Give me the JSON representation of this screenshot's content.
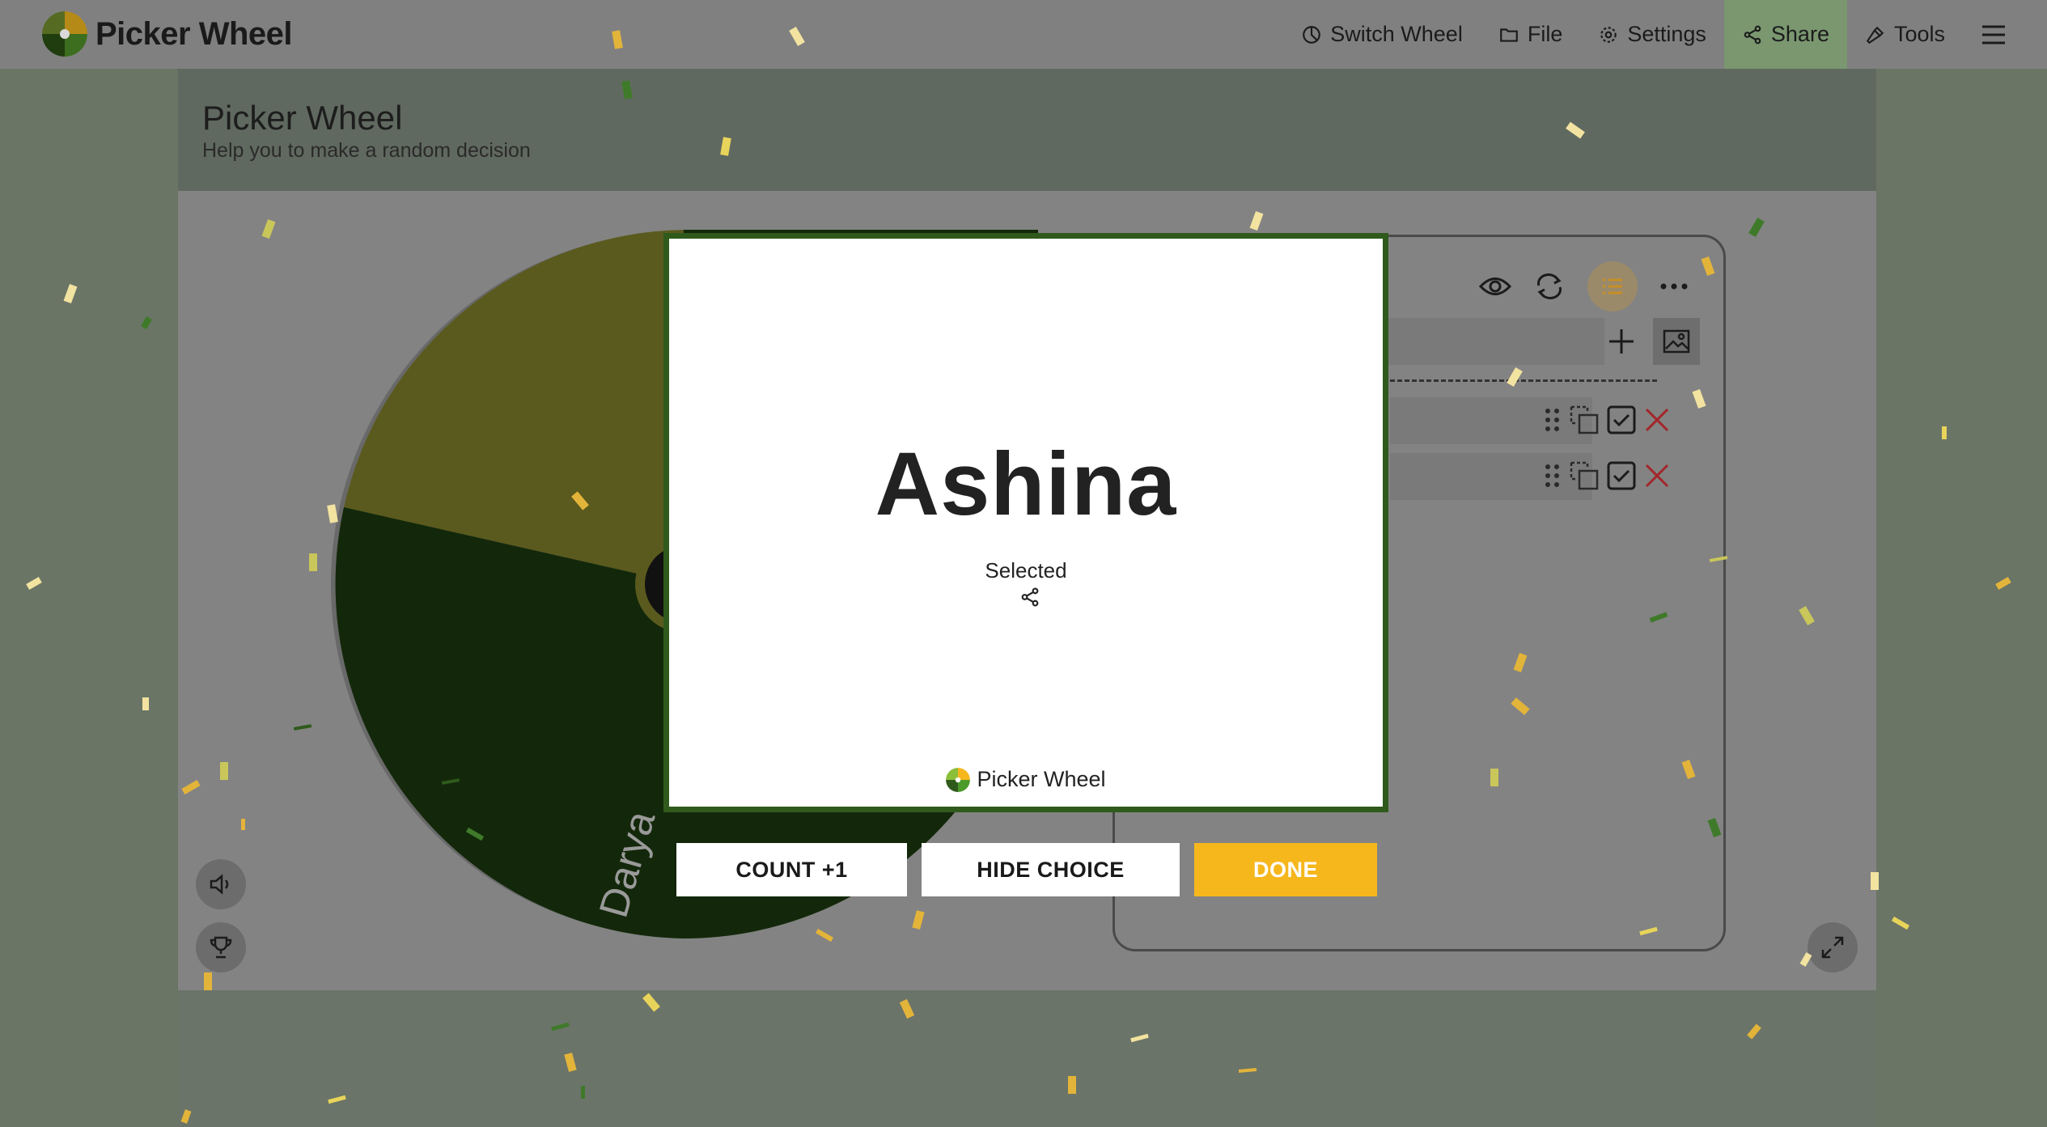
{
  "app": {
    "brand": "Picker Wheel",
    "colors": {
      "accent_green": "#2f5a1c",
      "done_yellow": "#f6b71d",
      "wheel_olive": "#5a5a1e",
      "wheel_dark_green": "#13280a"
    }
  },
  "navbar": {
    "items": [
      {
        "label": "Switch Wheel",
        "icon": "pie-chart-icon"
      },
      {
        "label": "File",
        "icon": "folder-icon"
      },
      {
        "label": "Settings",
        "icon": "gear-icon"
      },
      {
        "label": "Share",
        "icon": "share-icon"
      },
      {
        "label": "Tools",
        "icon": "hammer-icon"
      }
    ],
    "menu_icon": "hamburger-icon"
  },
  "page": {
    "title": "Picker Wheel",
    "subtitle": "Help you to make a random decision"
  },
  "wheel": {
    "visible_segment_label": "Darya"
  },
  "result_modal": {
    "selected_name": "Ashina",
    "selected_label": "Selected",
    "brand": "Picker Wheel",
    "buttons": {
      "count": "COUNT +1",
      "hide": "HIDE CHOICE",
      "done": "DONE"
    }
  }
}
